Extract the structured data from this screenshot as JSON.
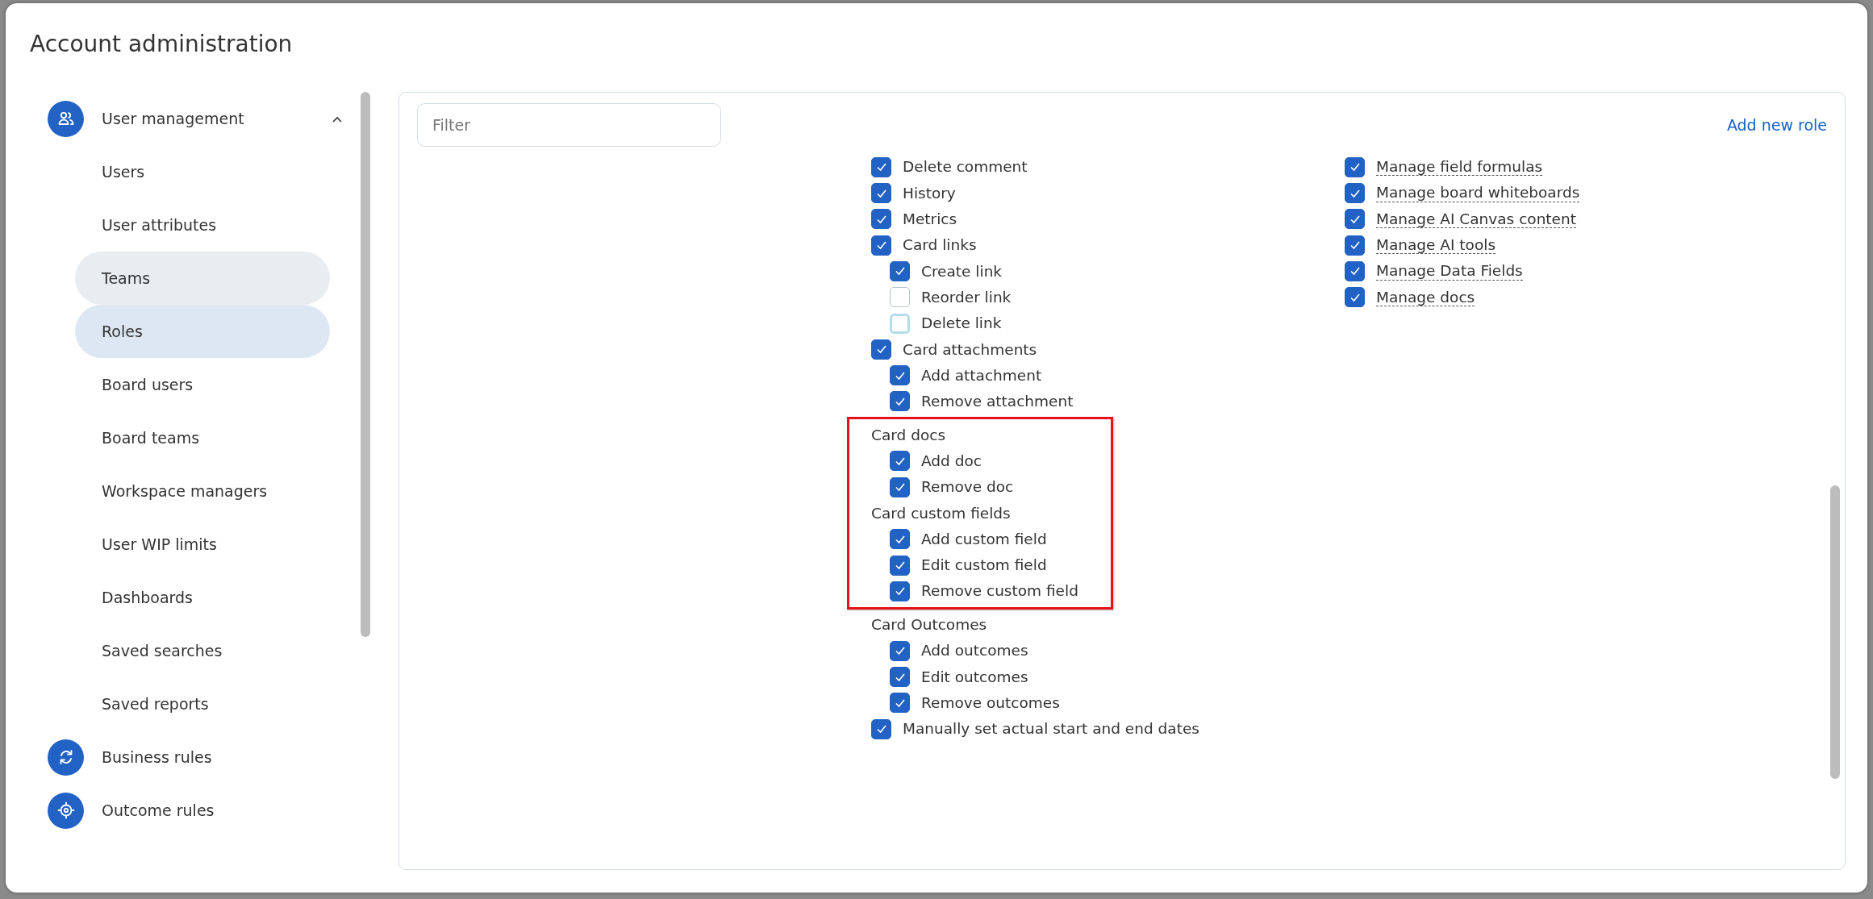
{
  "dialog": {
    "title": "Account administration"
  },
  "sidebar": {
    "items": [
      {
        "label": "User management",
        "expanded": true,
        "children": [
          {
            "label": "Users",
            "selected": false,
            "hovered": false
          },
          {
            "label": "User attributes",
            "selected": false,
            "hovered": false
          },
          {
            "label": "Teams",
            "selected": false,
            "hovered": true
          },
          {
            "label": "Roles",
            "selected": true,
            "hovered": false
          },
          {
            "label": "Board users",
            "selected": false,
            "hovered": false
          },
          {
            "label": "Board teams",
            "selected": false,
            "hovered": false
          },
          {
            "label": "Workspace managers",
            "selected": false,
            "hovered": false
          },
          {
            "label": "User WIP limits",
            "selected": false,
            "hovered": false
          },
          {
            "label": "Dashboards",
            "selected": false,
            "hovered": false
          },
          {
            "label": "Saved searches",
            "selected": false,
            "hovered": false
          },
          {
            "label": "Saved reports",
            "selected": false,
            "hovered": false
          }
        ]
      },
      {
        "label": "Business rules"
      },
      {
        "label": "Outcome rules"
      }
    ]
  },
  "filter": {
    "placeholder": "Filter"
  },
  "add_role_link": "Add new role",
  "permissions": {
    "columns": [
      [
        {
          "kind": "checkbox",
          "label": "Delete comment",
          "checked": true,
          "focused": false,
          "highlighted": false
        },
        {
          "kind": "checkbox",
          "label": "History",
          "checked": true,
          "focused": false,
          "highlighted": false
        },
        {
          "kind": "checkbox",
          "label": "Metrics",
          "checked": true,
          "focused": false,
          "highlighted": false
        },
        {
          "kind": "checkbox",
          "label": "Card links",
          "checked": true,
          "focused": false,
          "highlighted": false,
          "children": [
            {
              "kind": "checkbox",
              "label": "Create link",
              "checked": true,
              "focused": false
            },
            {
              "kind": "checkbox",
              "label": "Reorder link",
              "checked": false,
              "focused": false
            },
            {
              "kind": "checkbox",
              "label": "Delete link",
              "checked": false,
              "focused": true
            }
          ]
        },
        {
          "kind": "checkbox",
          "label": "Card attachments",
          "checked": true,
          "focused": false,
          "highlighted": false,
          "children": [
            {
              "kind": "checkbox",
              "label": "Add attachment",
              "checked": true,
              "focused": false
            },
            {
              "kind": "checkbox",
              "label": "Remove attachment",
              "checked": true,
              "focused": false
            }
          ]
        },
        {
          "kind": "heading",
          "label": "Card docs",
          "highlighted": true,
          "children": [
            {
              "kind": "checkbox",
              "label": "Add doc",
              "checked": true,
              "focused": false
            },
            {
              "kind": "checkbox",
              "label": "Remove doc",
              "checked": true,
              "focused": false
            }
          ]
        },
        {
          "kind": "heading",
          "label": "Card custom fields",
          "highlighted": true,
          "children": [
            {
              "kind": "checkbox",
              "label": "Add custom field",
              "checked": true,
              "focused": false
            },
            {
              "kind": "checkbox",
              "label": "Edit custom field",
              "checked": true,
              "focused": false
            },
            {
              "kind": "checkbox",
              "label": "Remove custom field",
              "checked": true,
              "focused": false
            }
          ]
        },
        {
          "kind": "heading",
          "label": "Card Outcomes",
          "highlighted": false,
          "children": [
            {
              "kind": "checkbox",
              "label": "Add outcomes",
              "checked": true,
              "focused": false
            },
            {
              "kind": "checkbox",
              "label": "Edit outcomes",
              "checked": true,
              "focused": false
            },
            {
              "kind": "checkbox",
              "label": "Remove outcomes",
              "checked": true,
              "focused": false
            }
          ]
        },
        {
          "kind": "checkbox",
          "label": "Manually set actual start and end dates",
          "checked": true,
          "focused": false,
          "highlighted": false
        }
      ],
      [
        {
          "kind": "hint-checkbox",
          "label": "Manage field formulas",
          "checked": true,
          "focused": false,
          "highlighted": false
        },
        {
          "kind": "hint-checkbox",
          "label": "Manage board whiteboards",
          "checked": true,
          "focused": false,
          "highlighted": false
        },
        {
          "kind": "hint-checkbox",
          "label": "Manage AI Canvas content",
          "checked": true,
          "focused": false,
          "highlighted": false
        },
        {
          "kind": "hint-checkbox",
          "label": "Manage AI tools",
          "checked": true,
          "focused": false,
          "highlighted": false
        },
        {
          "kind": "hint-checkbox",
          "label": "Manage Data Fields",
          "checked": true,
          "focused": false,
          "highlighted": false
        },
        {
          "kind": "hint-checkbox",
          "label": "Manage docs",
          "checked": true,
          "focused": false,
          "highlighted": false
        }
      ]
    ]
  }
}
